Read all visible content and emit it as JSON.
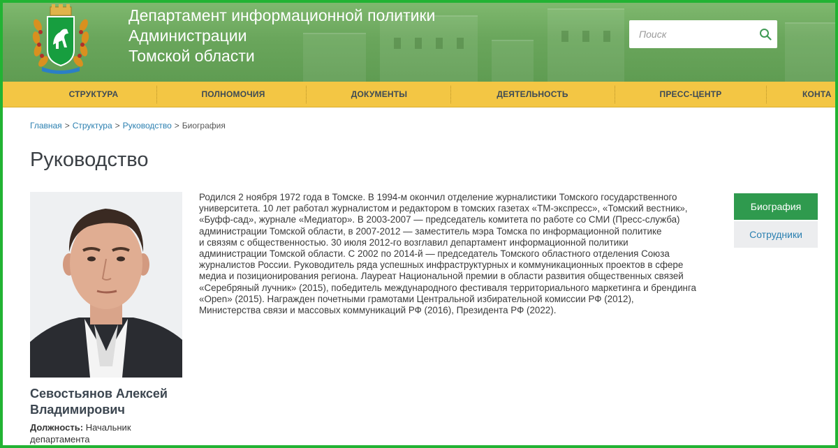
{
  "header": {
    "title_line1": "Департамент информационной политики",
    "title_line2": "Администрации",
    "title_line3": "Томской области",
    "search_placeholder": "Поиск",
    "search_icon": "search-icon",
    "emblem": "tomsk-region-emblem"
  },
  "nav": {
    "items": [
      {
        "label": "СТРУКТУРА"
      },
      {
        "label": "ПОЛНОМОЧИЯ"
      },
      {
        "label": "ДОКУМЕНТЫ"
      },
      {
        "label": "ДЕЯТЕЛЬНОСТЬ"
      },
      {
        "label": "ПРЕСС-ЦЕНТР"
      },
      {
        "label": "КОНТА"
      }
    ]
  },
  "breadcrumb": {
    "items": [
      "Главная",
      "Структура",
      "Руководство"
    ],
    "separator": ">",
    "current": "Биография"
  },
  "page_title": "Руководство",
  "person": {
    "name_line1": "Севостьянов Алексей",
    "name_line2": "Владимирович",
    "position_label": "Должность:",
    "position_value_line1": "Начальник",
    "position_value_line2": "департамента"
  },
  "bio": {
    "lines": [
      "Родился 2 ноября 1972 года в Томске. В 1994-м окончил отделение журналистики Томского государственного",
      "университета. 10 лет работал журналистом и редактором в томских газетах «ТМ-экспресс», «Томский вестник»,",
      "«Буфф-сад», журнале «Медиатор». В 2003-2007 — председатель комитета по работе со СМИ (Пресс-служба)",
      "администрации Томской области, в 2007-2012 — заместитель мэра Томска по информационной политике",
      "и связям с общественностью. 30 июля 2012-го возглавил департамент информационной политики",
      "администрации Томской области. С 2002 по 2014-й — председатель Томского областного отделения Союза",
      "журналистов России. Руководитель ряда успешных инфраструктурных и коммуникационных проектов в сфере",
      "медиа и позиционирования региона. Лауреат Национальной премии в области развития общественных связей",
      "«Серебряный лучник» (2015), победитель международного фестиваля территориального маркетинга и брендинга",
      "«Open» (2015). Награжден почетными грамотами Центральной избирательной комиссии РФ (2012),",
      "Министерства связи и массовых коммуникаций РФ (2016), Президента РФ (2022)."
    ]
  },
  "side_tabs": {
    "biography": "Биография",
    "staff": "Сотрудники"
  },
  "colors": {
    "header_green": "#6aa65c",
    "nav_yellow": "#f3c644",
    "active_tab": "#2f9a4e",
    "link_blue": "#2a7fb0",
    "frame_green": "#22b333"
  }
}
